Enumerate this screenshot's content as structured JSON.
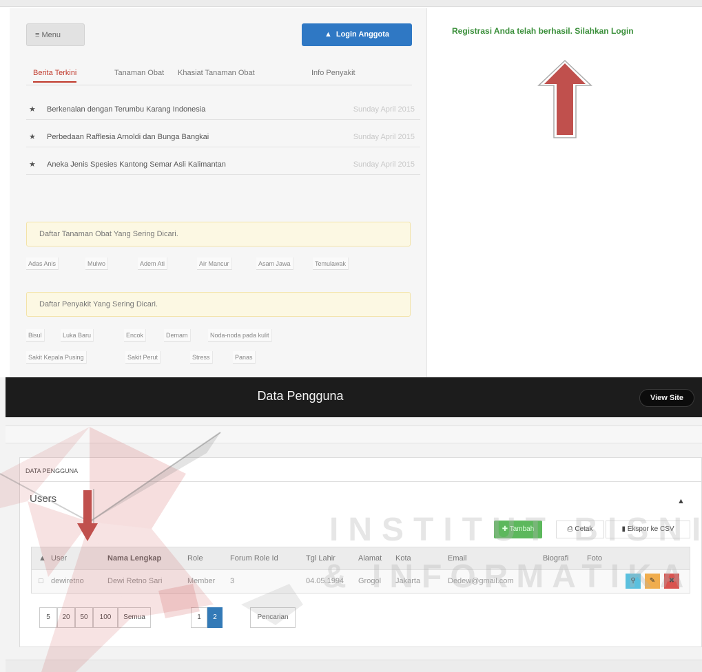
{
  "top": {
    "menu_label": "≡ Menu",
    "login_label": "Login Anggota",
    "tabs": [
      "Berita Terkini",
      "Tanaman Obat",
      "Khasiat Tanaman Obat",
      "Info Penyakit"
    ],
    "news": [
      {
        "title": "Berkenalan dengan Terumbu Karang Indonesia",
        "date": "Sunday April 2015"
      },
      {
        "title": "Perbedaan Rafflesia Arnoldi dan Bunga Bangkai",
        "date": "Sunday April 2015"
      },
      {
        "title": "Aneka Jenis Spesies Kantong Semar Asli Kalimantan",
        "date": "Sunday April 2015"
      }
    ],
    "popular_plants_label": "Daftar Tanaman Obat Yang Sering Dicari.",
    "plants": [
      "Adas Anis",
      "Mulwo",
      "Adem Ati",
      "Air Mancur",
      "Asam Jawa",
      "Temulawak"
    ],
    "popular_diseases_label": "Daftar Penyakit Yang Sering Dicari.",
    "diseases_row1": [
      "Bisul",
      "Luka Baru",
      "Encok",
      "Demam",
      "Noda-noda pada kulit"
    ],
    "diseases_row2": [
      "Sakit Kepala Pusing",
      "Sakit Perut",
      "Stress",
      "Panas"
    ],
    "registration_message": "Registrasi Anda telah berhasil. Silahkan Login"
  },
  "bottom": {
    "title": "Data Pengguna",
    "view_site": "View Site",
    "section_label": "DATA PENGGUNA",
    "card_title": "Users",
    "btn_tambah": "Tambah",
    "btn_cetak": "Cetak",
    "btn_csv": "Ekspor ke CSV",
    "columns": [
      "User",
      "Nama Lengkap",
      "Role",
      "Forum Role Id",
      "Tgl Lahir",
      "Alamat",
      "Kota",
      "Email",
      "Biografi",
      "Foto"
    ],
    "row": {
      "user": "dewiretno",
      "nama": "Dewi Retno Sari",
      "role": "Member",
      "forum_role": "3",
      "tgl_lahir": "04.05.1994",
      "alamat": "Grogol",
      "kota": "Jakarta",
      "email": "Dedew@gmail.com",
      "biografi": "",
      "foto": ""
    },
    "page_sizes": [
      "5",
      "20",
      "50",
      "100",
      "Semua"
    ],
    "pages": [
      "1",
      "2"
    ],
    "search_label": "Pencarian"
  },
  "watermark": {
    "line1": "INSTITUT BISNIS",
    "line2": "& INFORMATIKA"
  },
  "colors": {
    "arrow_red": "#c0504d",
    "login_blue": "#2f78c4",
    "success_green": "#3a8f3a",
    "tambah_green": "#5cb85c",
    "pagination_blue": "#337ab7",
    "header_black": "#1c1c1c"
  }
}
